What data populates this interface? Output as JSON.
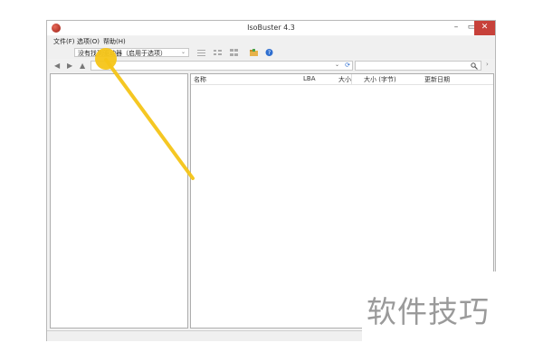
{
  "window": {
    "title": "IsoBuster 4.3"
  },
  "menu": {
    "file": "文件(F)",
    "options": "选项(O)",
    "help": "帮助(H)"
  },
  "toolbar": {
    "device_select_text": "没有找到驱动器（启用于选项）"
  },
  "columns": [
    "名称",
    "LBA",
    "大小",
    "大小 (字节)",
    "更新日期"
  ],
  "watermark": "软件技巧",
  "icons": [
    "app-icon",
    "minimize-icon",
    "maximize-icon",
    "close-icon",
    "chevron-down-icon",
    "view-list-icon",
    "view-details-icon",
    "view-grid-icon",
    "folder-icon",
    "help-icon",
    "back-icon",
    "forward-icon",
    "up-icon",
    "refresh-icon",
    "search-icon",
    "chevron-right-icon"
  ],
  "colors": {
    "close_button": "#c7413a",
    "annotation": "#f5c518",
    "help_icon": "#2f6fd0"
  }
}
